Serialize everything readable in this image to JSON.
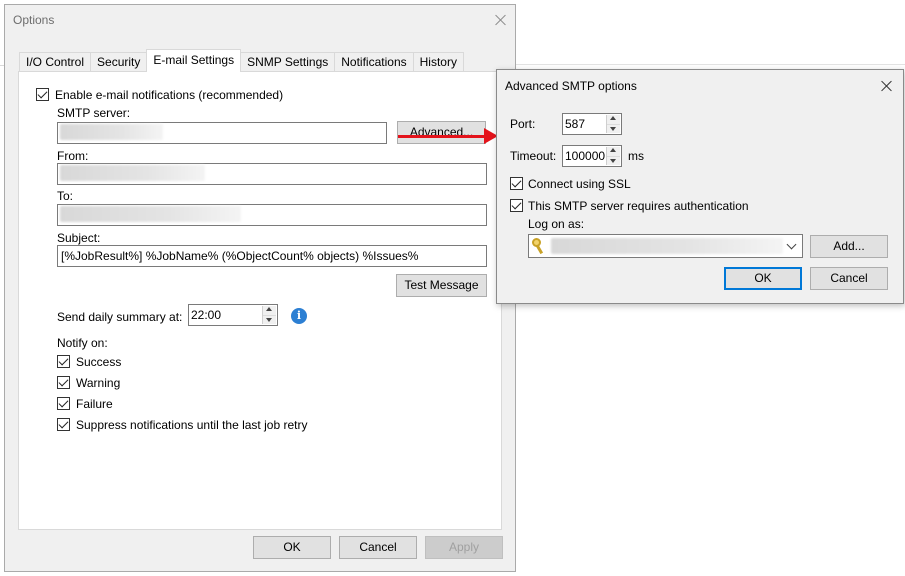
{
  "options_window": {
    "title": "Options",
    "tabs": [
      {
        "label": "I/O Control",
        "active": false
      },
      {
        "label": "Security",
        "active": false
      },
      {
        "label": "E-mail Settings",
        "active": true
      },
      {
        "label": "SNMP Settings",
        "active": false
      },
      {
        "label": "Notifications",
        "active": false
      },
      {
        "label": "History",
        "active": false
      }
    ],
    "email": {
      "enable_label": "Enable e-mail notifications (recommended)",
      "enable_checked": true,
      "smtp_label": "SMTP server:",
      "smtp_value": "",
      "advanced_button": "Advanced...",
      "from_label": "From:",
      "from_value": "",
      "to_label": "To:",
      "to_value": "",
      "subject_label": "Subject:",
      "subject_value": "[%JobResult%] %JobName% (%ObjectCount% objects) %Issues%",
      "test_button": "Test Message",
      "daily_label": "Send daily summary at:",
      "daily_value": "22:00",
      "info_icon": "info-icon",
      "notify_label": "Notify on:",
      "notify": [
        {
          "label": "Success",
          "checked": true
        },
        {
          "label": "Warning",
          "checked": true
        },
        {
          "label": "Failure",
          "checked": true
        },
        {
          "label": "Suppress notifications until the last job retry",
          "checked": true
        }
      ]
    },
    "buttons": {
      "ok": "OK",
      "cancel": "Cancel",
      "apply": "Apply"
    }
  },
  "advanced_dialog": {
    "title": "Advanced SMTP options",
    "port_label": "Port:",
    "port_value": "587",
    "timeout_label": "Timeout:",
    "timeout_value": "100000",
    "timeout_unit": "ms",
    "ssl_label": "Connect using SSL",
    "ssl_checked": true,
    "auth_label": "This SMTP server requires authentication",
    "auth_checked": true,
    "logon_label": "Log on as:",
    "logon_value": "",
    "add_button": "Add...",
    "ok_button": "OK",
    "cancel_button": "Cancel"
  },
  "colors": {
    "accent": "#0078d7",
    "arrow": "#e4131b",
    "window_bg": "#f0f0f0"
  }
}
